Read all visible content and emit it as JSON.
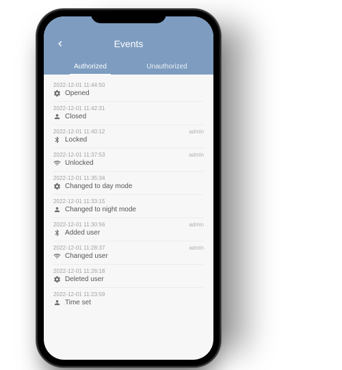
{
  "header": {
    "title": "Events"
  },
  "tabs": {
    "authorized": "Authorized",
    "unauthorized": "Unauthorized"
  },
  "events": [
    {
      "timestamp": "2022-12-01 11:44:50",
      "icon": "gear",
      "action": "Opened",
      "user": ""
    },
    {
      "timestamp": "2022-12-01 11:42:31",
      "icon": "person",
      "action": "Closed",
      "user": ""
    },
    {
      "timestamp": "2022-12-01 11:40:12",
      "icon": "bluetooth",
      "action": "Locked",
      "user": "admin"
    },
    {
      "timestamp": "2022-12-01 11:37:53",
      "icon": "wifi",
      "action": "Unlocked",
      "user": "admin"
    },
    {
      "timestamp": "2022-12-01 11:35:34",
      "icon": "gear",
      "action": "Changed to day mode",
      "user": ""
    },
    {
      "timestamp": "2022-12-01 11:33:15",
      "icon": "person",
      "action": "Changed to night mode",
      "user": ""
    },
    {
      "timestamp": "2022-12-01 11:30:56",
      "icon": "bluetooth",
      "action": "Added user",
      "user": "admin"
    },
    {
      "timestamp": "2022-12-01 11:28:37",
      "icon": "wifi",
      "action": "Changed user",
      "user": "admin"
    },
    {
      "timestamp": "2022-12-01 11:26:18",
      "icon": "gear",
      "action": "Deleted user",
      "user": ""
    },
    {
      "timestamp": "2022-12-01 11:23:59",
      "icon": "person",
      "action": "Time set",
      "user": ""
    }
  ]
}
